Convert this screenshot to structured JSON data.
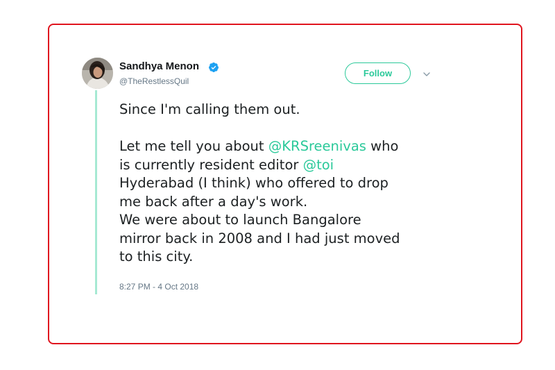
{
  "tweet": {
    "author": {
      "name": "Sandhya Menon",
      "handle": "@TheRestlessQuil",
      "verified": true,
      "avatar_icon": "user-avatar-photo"
    },
    "follow_label": "Follow",
    "menu_icon": "chevron-down-icon",
    "text": {
      "line1": "Since I'm calling them out.",
      "line2_pre": "Let me tell you about ",
      "mention1": "@KRSreenivas",
      "line2_post": " who",
      "line3_pre": "is currently resident editor ",
      "mention2": "@toi",
      "line4": "Hyderabad (I think) who offered to drop",
      "line5": "me back after a day's work.",
      "line6": "We were about to launch Bangalore",
      "line7": "mirror back in 2008 and I had just moved",
      "line8": "to this city."
    },
    "timestamp": "8:27 PM - 4 Oct 2018"
  },
  "colors": {
    "accent": "#2bc99a",
    "thread_line": "#a6e9d3",
    "frame_border": "#e0141e",
    "verified_badge": "#1da1f2",
    "secondary_text": "#657786"
  }
}
